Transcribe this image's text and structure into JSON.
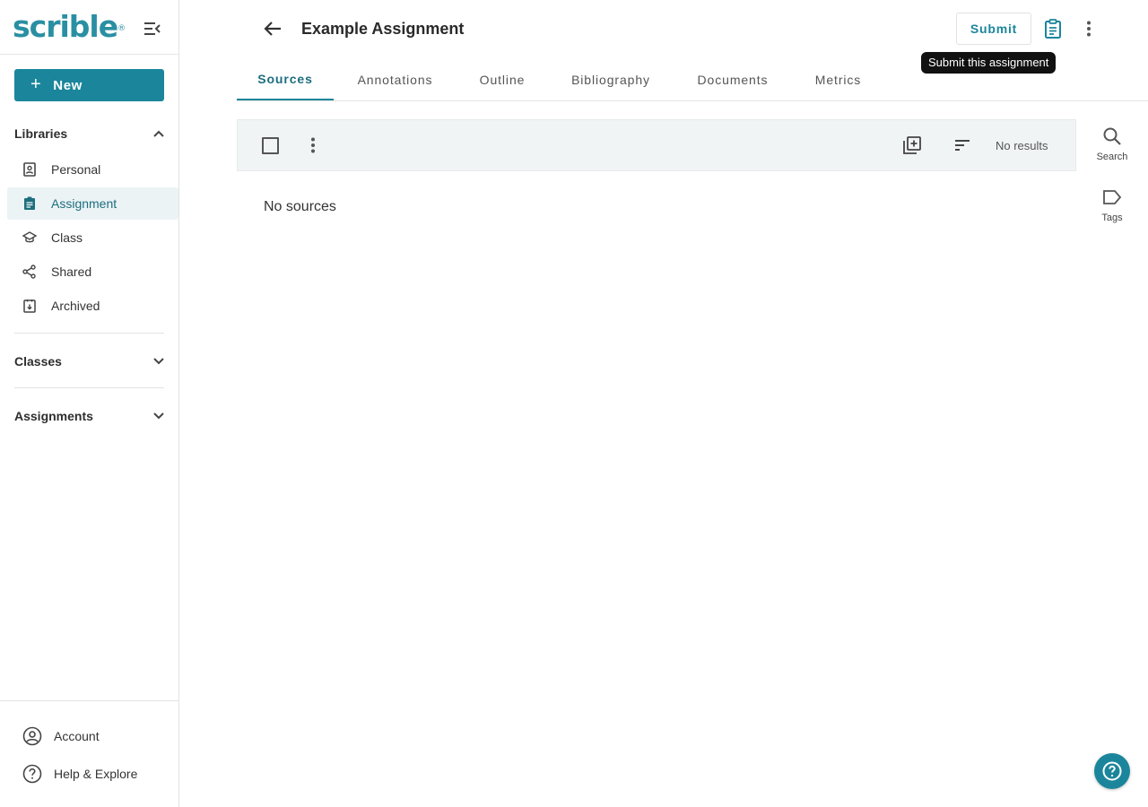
{
  "app": {
    "logo_text": "scrible",
    "logo_mark": "®"
  },
  "colors": {
    "accent": "#1b869b",
    "accent_dark": "#1d6e7e",
    "active_bg": "#ebf3f5",
    "toolbar_bg": "#f1f4f5"
  },
  "sidebar": {
    "new_label": "New",
    "libraries_label": "Libraries",
    "items": [
      {
        "label": "Personal",
        "icon": "contact-book-icon"
      },
      {
        "label": "Assignment",
        "icon": "assignment-icon",
        "active": true
      },
      {
        "label": "Class",
        "icon": "graduation-cap-icon"
      },
      {
        "label": "Shared",
        "icon": "share-icon"
      },
      {
        "label": "Archived",
        "icon": "archive-icon"
      }
    ],
    "classes_label": "Classes",
    "assignments_label": "Assignments",
    "bottom": [
      {
        "label": "Account",
        "icon": "account-circle-icon"
      },
      {
        "label": "Help & Explore",
        "icon": "help-circle-icon"
      }
    ]
  },
  "header": {
    "title": "Example Assignment",
    "submit_label": "Submit",
    "tooltip": "Submit this assignment"
  },
  "tabs": [
    {
      "label": "Sources",
      "active": true
    },
    {
      "label": "Annotations"
    },
    {
      "label": "Outline"
    },
    {
      "label": "Bibliography"
    },
    {
      "label": "Documents"
    },
    {
      "label": "Metrics"
    }
  ],
  "toolbar": {
    "results_text": "No results"
  },
  "main": {
    "empty_text": "No sources"
  },
  "rail": {
    "search_label": "Search",
    "tags_label": "Tags"
  }
}
